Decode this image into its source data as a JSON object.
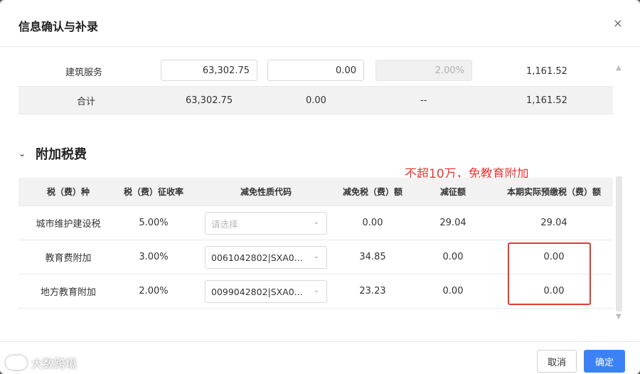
{
  "dialog": {
    "title": "信息确认与补录",
    "close_icon": "×"
  },
  "top_table": {
    "row1": {
      "name": "建筑服务",
      "value1": "63,302.75",
      "value2": "0.00",
      "rate": "2.00%",
      "total": "1,161.52"
    },
    "row2": {
      "name": "合计",
      "value1": "63,302.75",
      "value2": "0.00",
      "rate": "--",
      "total": "1,161.52"
    }
  },
  "section": {
    "chevron": "⌄",
    "title": "附加税费",
    "note": "不超10万，免教育附加"
  },
  "bottom_table": {
    "headers": [
      "税（费）种",
      "税（费）征收率",
      "减免性质代码",
      "减免税（费）额",
      "减征额",
      "本期实际预缴税（费）额"
    ],
    "rows": [
      {
        "name": "城市维护建设税",
        "rate": "5.00%",
        "code": "",
        "placeholder": "请选择",
        "reduce": "0.00",
        "levy": "29.04",
        "actual": "29.04"
      },
      {
        "name": "教育费附加",
        "rate": "3.00%",
        "code": "0061042802|SXA0...",
        "placeholder": "",
        "reduce": "34.85",
        "levy": "0.00",
        "actual": "0.00"
      },
      {
        "name": "地方教育附加",
        "rate": "2.00%",
        "code": "0099042802|SXA0...",
        "placeholder": "",
        "reduce": "23.23",
        "levy": "0.00",
        "actual": "0.00"
      }
    ]
  },
  "footer": {
    "cancel": "取消",
    "ok": "确定"
  },
  "watermark": "大数跨境",
  "colors": {
    "accent": "#3b82f6",
    "highlight": "#e53935"
  }
}
